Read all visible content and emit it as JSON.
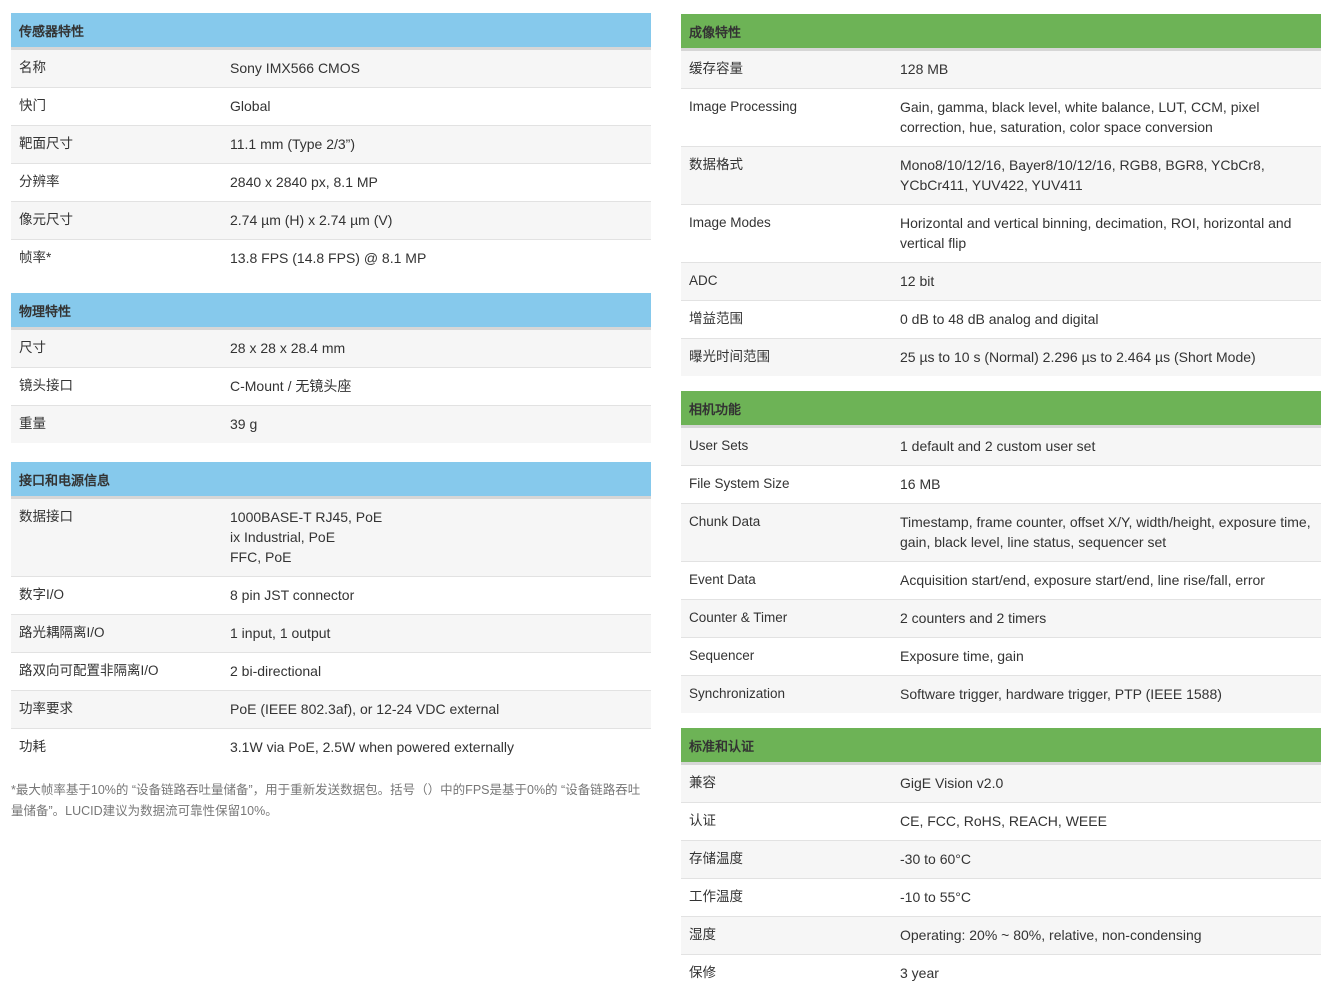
{
  "left": {
    "sensor": {
      "title": "传感器特性",
      "rows": [
        {
          "label": "名称",
          "value": "Sony IMX566 CMOS"
        },
        {
          "label": "快门",
          "value": "Global"
        },
        {
          "label": "靶面尺寸",
          "value": "11.1 mm (Type 2/3”)"
        },
        {
          "label": "分辨率",
          "value": "2840 x 2840 px, 8.1 MP"
        },
        {
          "label": "像元尺寸",
          "value": "2.74 µm (H) x 2.74 µm (V)"
        },
        {
          "label": "帧率*",
          "value": "13.8 FPS (14.8 FPS) @ 8.1 MP"
        }
      ]
    },
    "physical": {
      "title": "物理特性",
      "rows": [
        {
          "label": "尺寸",
          "value": "28 x 28 x 28.4 mm"
        },
        {
          "label": "镜头接口",
          "value": "C-Mount / 无镜头座"
        },
        {
          "label": "重量",
          "value": "39 g"
        }
      ]
    },
    "interface": {
      "title": "接口和电源信息",
      "rows": [
        {
          "label": "数据接口",
          "lines": [
            "1000BASE-T RJ45, PoE",
            "ix Industrial, PoE",
            "FFC, PoE"
          ]
        },
        {
          "label": "数字I/O",
          "value": "8 pin JST connector"
        },
        {
          "label": "路光耦隔离I/O",
          "value": "1 input, 1 output"
        },
        {
          "label": "路双向可配置非隔离I/O",
          "value": "2 bi-directional"
        },
        {
          "label": "功率要求",
          "value": "PoE (IEEE 802.3af), or 12-24 VDC external"
        },
        {
          "label": "功耗",
          "value": "3.1W via PoE, 2.5W when powered externally"
        }
      ]
    },
    "footnote": "*最大帧率基于10%的 “设备链路吞吐量储备”，用于重新发送数据包。括号（）中的FPS是基于0%的 “设备链路吞吐量储备”。LUCID建议为数据流可靠性保留10%。"
  },
  "right": {
    "imaging": {
      "title": "成像特性",
      "rows": [
        {
          "label": "缓存容量",
          "value": "128 MB"
        },
        {
          "label": "Image Processing",
          "value": "Gain, gamma, black level, white balance, LUT, CCM, pixel correction, hue, saturation, color space conversion"
        },
        {
          "label": "数据格式",
          "value": "Mono8/10/12/16, Bayer8/10/12/16, RGB8, BGR8, YCbCr8, YCbCr411, YUV422, YUV411"
        },
        {
          "label": "Image Modes",
          "value": "Horizontal and vertical binning, decimation, ROI, horizontal and vertical flip"
        },
        {
          "label": "ADC",
          "value": "12 bit"
        },
        {
          "label": "增益范围",
          "value": "0 dB to 48 dB analog and digital"
        },
        {
          "label": "曝光时间范围",
          "value": "25 µs to 10 s (Normal) 2.296 µs to 2.464 µs (Short Mode)"
        }
      ]
    },
    "camera": {
      "title": "相机功能",
      "rows": [
        {
          "label": "User Sets",
          "value": "1 default and 2 custom user set"
        },
        {
          "label": "File System Size",
          "value": "16 MB"
        },
        {
          "label": "Chunk Data",
          "value": "Timestamp, frame counter, offset X/Y, width/height, exposure time, gain, black level, line status, sequencer set"
        },
        {
          "label": "Event Data",
          "value": "Acquisition start/end, exposure start/end, line rise/fall, error"
        },
        {
          "label": "Counter & Timer",
          "value": "2 counters and 2 timers"
        },
        {
          "label": "Sequencer",
          "value": "Exposure time, gain"
        },
        {
          "label": "Synchronization",
          "value": "Software trigger, hardware trigger, PTP (IEEE 1588)"
        }
      ]
    },
    "standards": {
      "title": "标准和认证",
      "rows": [
        {
          "label": "兼容",
          "value": "GigE Vision v2.0"
        },
        {
          "label": "认证",
          "value": "CE, FCC, RoHS, REACH, WEEE"
        },
        {
          "label": "存储温度",
          "value": "-30 to 60°C"
        },
        {
          "label": "工作温度",
          "value": "-10 to 55°C"
        },
        {
          "label": "湿度",
          "value": "Operating: 20% ~ 80%, relative, non-condensing"
        },
        {
          "label": "保修",
          "value": "3 year"
        }
      ]
    }
  },
  "colors": {
    "left_header_bg": "#86c9ec",
    "right_header_bg": "#6db356",
    "row_alt_bg": "#f6f6f6",
    "text": "#333333",
    "footnote_text": "#777777"
  }
}
